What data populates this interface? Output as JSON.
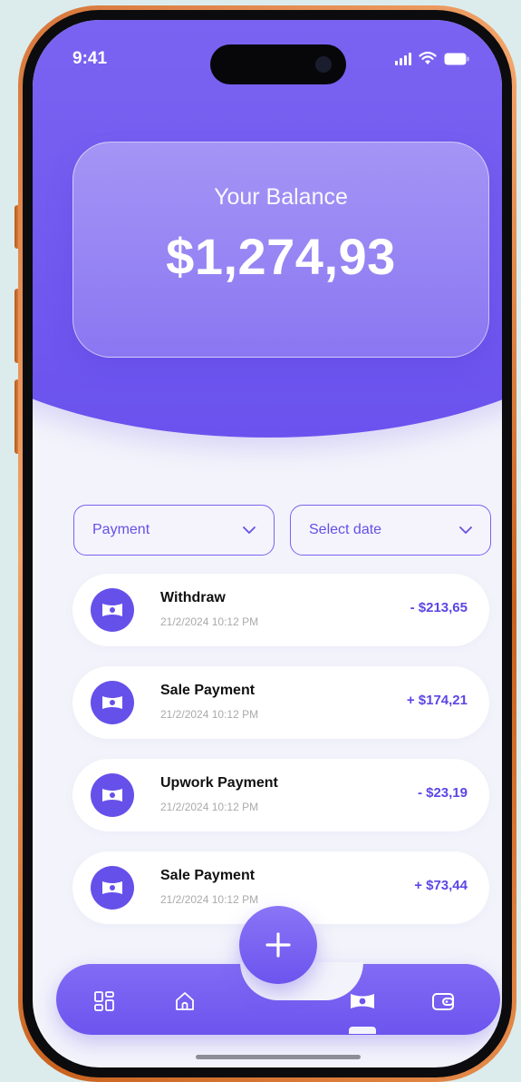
{
  "status_bar": {
    "time": "9:41"
  },
  "balance": {
    "label": "Your Balance",
    "amount": "$1,274,93"
  },
  "filters": {
    "category": "Payment",
    "date_placeholder": "Select date"
  },
  "transactions": [
    {
      "title": "Withdraw",
      "date": "21/2/2024  10:12 PM",
      "amount": "- $213,65"
    },
    {
      "title": "Sale Payment",
      "date": "21/2/2024  10:12 PM",
      "amount": "+ $174,21"
    },
    {
      "title": "Upwork Payment",
      "date": "21/2/2024  10:12 PM",
      "amount": "- $23,19"
    },
    {
      "title": "Sale Payment",
      "date": "21/2/2024  10:12 PM",
      "amount": "+ $73,44"
    }
  ],
  "nav": {
    "items": [
      {
        "icon": "dashboard-icon"
      },
      {
        "icon": "home-icon"
      },
      {
        "icon": "add-icon"
      },
      {
        "icon": "money-icon",
        "active": true
      },
      {
        "icon": "wallet-icon"
      }
    ]
  },
  "colors": {
    "primary": "#6b52ee",
    "header_light": "#8f7bf6",
    "background": "#f3f3fb",
    "frame": "#d7763a"
  }
}
